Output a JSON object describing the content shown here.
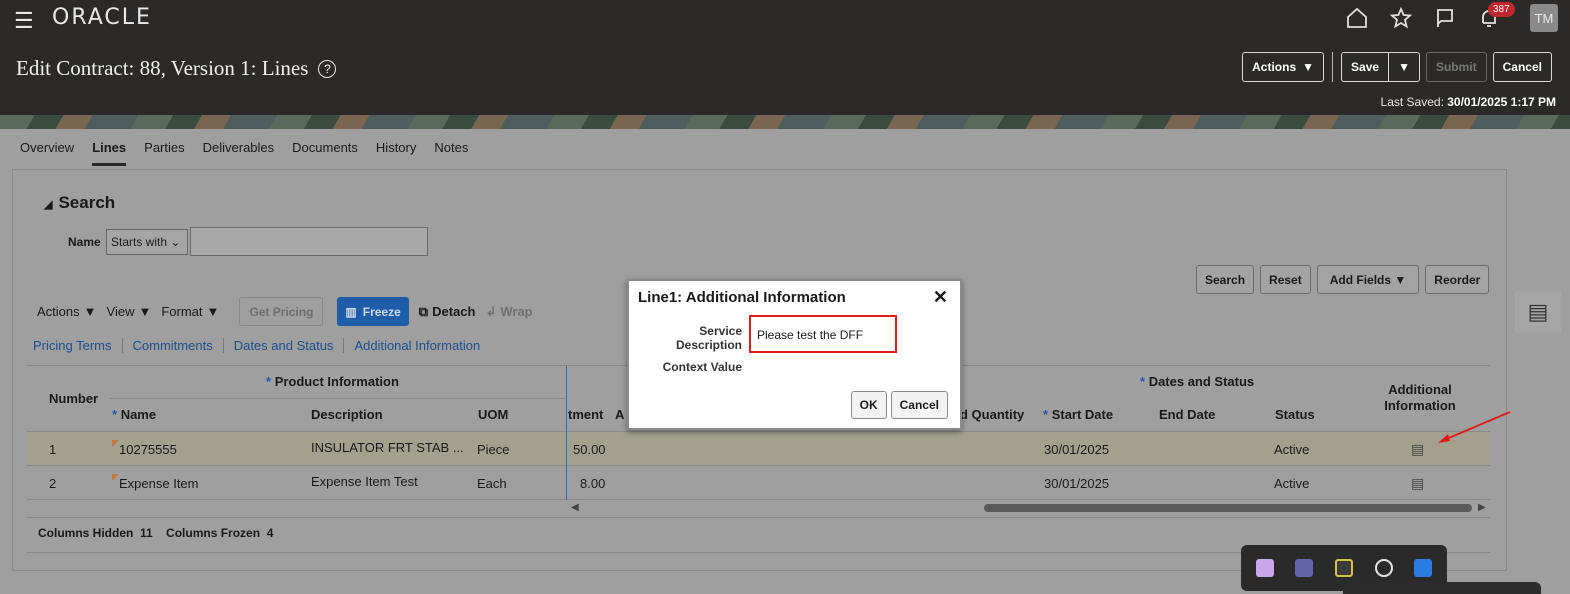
{
  "header": {
    "logo": "ORACLE",
    "notification_count": "387",
    "avatar_initials": "TM",
    "page_title": "Edit Contract: 88, Version 1: Lines",
    "buttons": {
      "actions": "Actions",
      "save": "Save",
      "submit": "Submit",
      "cancel": "Cancel"
    },
    "last_saved_label": "Last Saved:",
    "last_saved_value": "30/01/2025 1:17 PM"
  },
  "tabs": [
    "Overview",
    "Lines",
    "Parties",
    "Deliverables",
    "Documents",
    "History",
    "Notes"
  ],
  "search": {
    "title": "Search",
    "name_label": "Name",
    "operator": "Starts with",
    "buttons": {
      "search": "Search",
      "reset": "Reset",
      "add_fields": "Add Fields",
      "reorder": "Reorder"
    }
  },
  "toolbar": {
    "actions": "Actions",
    "view": "View",
    "format": "Format",
    "get_pricing": "Get Pricing",
    "freeze": "Freeze",
    "detach": "Detach",
    "wrap": "Wrap"
  },
  "subtabs": [
    "Pricing Terms",
    "Commitments",
    "Dates and Status",
    "Additional Information"
  ],
  "table": {
    "group_product": "Product Information",
    "group_dates": "Dates and Status",
    "col_number": "Number",
    "col_name": "Name",
    "col_description": "Description",
    "col_uom": "UOM",
    "col_commitment": "tment",
    "col_a": "A",
    "col_ordered_qty": "d Quantity",
    "col_start": "Start Date",
    "col_end": "End Date",
    "col_status": "Status",
    "col_additional": "Additional Information",
    "rows": [
      {
        "number": "1",
        "name": "10275555",
        "description": "INSULATOR FRT STAB ...",
        "uom": "Piece",
        "amount": "50.00",
        "start": "30/01/2025",
        "status": "Active"
      },
      {
        "number": "2",
        "name": "Expense Item",
        "description": "Expense Item Test",
        "uom": "Each",
        "amount": "8.00",
        "start": "30/01/2025",
        "status": "Active"
      }
    ]
  },
  "footer": {
    "hidden_label": "Columns Hidden",
    "hidden_count": "11",
    "frozen_label": "Columns Frozen",
    "frozen_count": "4"
  },
  "dialog": {
    "title": "Line1: Additional Information",
    "service_label_1": "Service",
    "service_label_2": "Description",
    "service_value": "Please test the DFF",
    "context_label": "Context Value",
    "ok": "OK",
    "cancel": "Cancel"
  },
  "colors": {
    "header_bg": "#2b2a28",
    "freeze_blue": "#1f5da8",
    "highlight_red": "#e01b1b"
  }
}
